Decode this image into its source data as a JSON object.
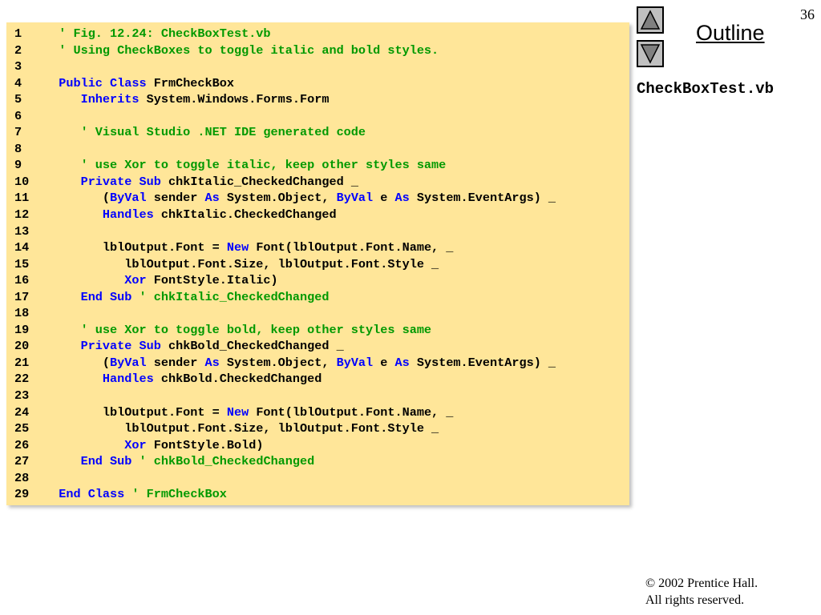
{
  "slide": {
    "page_number": "36",
    "outline_label": "Outline",
    "file_name": "CheckBoxTest.vb",
    "copyright_line1": "© 2002 Prentice Hall.",
    "copyright_line2": "All rights reserved."
  },
  "nav": {
    "prev_icon": "triangle-up-icon",
    "next_icon": "triangle-down-icon"
  },
  "colors": {
    "code_background": "#ffe699",
    "keyword": "#0000ff",
    "comment": "#009900",
    "text": "#000000"
  },
  "code": [
    {
      "n": "1",
      "segs": [
        {
          "t": "  ",
          "c": ""
        },
        {
          "t": "' Fig. 12.24: CheckBoxTest.vb",
          "c": "cm"
        }
      ]
    },
    {
      "n": "2",
      "segs": [
        {
          "t": "  ",
          "c": ""
        },
        {
          "t": "' Using CheckBoxes to toggle italic and bold styles.",
          "c": "cm"
        }
      ]
    },
    {
      "n": "3",
      "segs": []
    },
    {
      "n": "4",
      "segs": [
        {
          "t": "  ",
          "c": ""
        },
        {
          "t": "Public",
          "c": "kw"
        },
        {
          "t": " ",
          "c": ""
        },
        {
          "t": "Class",
          "c": "kw"
        },
        {
          "t": " FrmCheckBox",
          "c": ""
        }
      ]
    },
    {
      "n": "5",
      "segs": [
        {
          "t": "     ",
          "c": ""
        },
        {
          "t": "Inherits",
          "c": "kw"
        },
        {
          "t": " System.Windows.Forms.Form",
          "c": ""
        }
      ]
    },
    {
      "n": "6",
      "segs": []
    },
    {
      "n": "7",
      "segs": [
        {
          "t": "     ",
          "c": ""
        },
        {
          "t": "' Visual Studio .NET IDE generated code",
          "c": "cm"
        }
      ]
    },
    {
      "n": "8",
      "segs": []
    },
    {
      "n": "9",
      "segs": [
        {
          "t": "     ",
          "c": ""
        },
        {
          "t": "' use Xor to toggle italic, keep other styles same",
          "c": "cm"
        }
      ]
    },
    {
      "n": "10",
      "segs": [
        {
          "t": "     ",
          "c": ""
        },
        {
          "t": "Private",
          "c": "kw"
        },
        {
          "t": " ",
          "c": ""
        },
        {
          "t": "Sub",
          "c": "kw"
        },
        {
          "t": " chkItalic_CheckedChanged _",
          "c": ""
        }
      ]
    },
    {
      "n": "11",
      "segs": [
        {
          "t": "        (",
          "c": ""
        },
        {
          "t": "ByVal",
          "c": "kw"
        },
        {
          "t": " sender ",
          "c": ""
        },
        {
          "t": "As",
          "c": "kw"
        },
        {
          "t": " System.Object, ",
          "c": ""
        },
        {
          "t": "ByVal",
          "c": "kw"
        },
        {
          "t": " e ",
          "c": ""
        },
        {
          "t": "As",
          "c": "kw"
        },
        {
          "t": " System.EventArgs) _",
          "c": ""
        }
      ]
    },
    {
      "n": "12",
      "segs": [
        {
          "t": "        ",
          "c": ""
        },
        {
          "t": "Handles",
          "c": "kw"
        },
        {
          "t": " chkItalic.CheckedChanged",
          "c": ""
        }
      ]
    },
    {
      "n": "13",
      "segs": []
    },
    {
      "n": "14",
      "segs": [
        {
          "t": "        lblOutput.Font = ",
          "c": ""
        },
        {
          "t": "New",
          "c": "kw"
        },
        {
          "t": " Font(lblOutput.Font.Name, _",
          "c": ""
        }
      ]
    },
    {
      "n": "15",
      "segs": [
        {
          "t": "           lblOutput.Font.Size, lblOutput.Font.Style _",
          "c": ""
        }
      ]
    },
    {
      "n": "16",
      "segs": [
        {
          "t": "           ",
          "c": ""
        },
        {
          "t": "Xor",
          "c": "kw"
        },
        {
          "t": " FontStyle.Italic)",
          "c": ""
        }
      ]
    },
    {
      "n": "17",
      "segs": [
        {
          "t": "     ",
          "c": ""
        },
        {
          "t": "End",
          "c": "kw"
        },
        {
          "t": " ",
          "c": ""
        },
        {
          "t": "Sub",
          "c": "kw"
        },
        {
          "t": " ",
          "c": ""
        },
        {
          "t": "' chkItalic_CheckedChanged",
          "c": "cm"
        }
      ]
    },
    {
      "n": "18",
      "segs": []
    },
    {
      "n": "19",
      "segs": [
        {
          "t": "     ",
          "c": ""
        },
        {
          "t": "' use Xor to toggle bold, keep other styles same",
          "c": "cm"
        }
      ]
    },
    {
      "n": "20",
      "segs": [
        {
          "t": "     ",
          "c": ""
        },
        {
          "t": "Private",
          "c": "kw"
        },
        {
          "t": " ",
          "c": ""
        },
        {
          "t": "Sub",
          "c": "kw"
        },
        {
          "t": " chkBold_CheckedChanged _",
          "c": ""
        }
      ]
    },
    {
      "n": "21",
      "segs": [
        {
          "t": "        (",
          "c": ""
        },
        {
          "t": "ByVal",
          "c": "kw"
        },
        {
          "t": " sender ",
          "c": ""
        },
        {
          "t": "As",
          "c": "kw"
        },
        {
          "t": " System.Object, ",
          "c": ""
        },
        {
          "t": "ByVal",
          "c": "kw"
        },
        {
          "t": " e ",
          "c": ""
        },
        {
          "t": "As",
          "c": "kw"
        },
        {
          "t": " System.EventArgs) _",
          "c": ""
        }
      ]
    },
    {
      "n": "22",
      "segs": [
        {
          "t": "        ",
          "c": ""
        },
        {
          "t": "Handles",
          "c": "kw"
        },
        {
          "t": " chkBold.CheckedChanged",
          "c": ""
        }
      ]
    },
    {
      "n": "23",
      "segs": []
    },
    {
      "n": "24",
      "segs": [
        {
          "t": "        lblOutput.Font = ",
          "c": ""
        },
        {
          "t": "New",
          "c": "kw"
        },
        {
          "t": " Font(lblOutput.Font.Name, _",
          "c": ""
        }
      ]
    },
    {
      "n": "25",
      "segs": [
        {
          "t": "           lblOutput.Font.Size, lblOutput.Font.Style _",
          "c": ""
        }
      ]
    },
    {
      "n": "26",
      "segs": [
        {
          "t": "           ",
          "c": ""
        },
        {
          "t": "Xor",
          "c": "kw"
        },
        {
          "t": " FontStyle.Bold)",
          "c": ""
        }
      ]
    },
    {
      "n": "27",
      "segs": [
        {
          "t": "     ",
          "c": ""
        },
        {
          "t": "End",
          "c": "kw"
        },
        {
          "t": " ",
          "c": ""
        },
        {
          "t": "Sub",
          "c": "kw"
        },
        {
          "t": " ",
          "c": ""
        },
        {
          "t": "' chkBold_CheckedChanged",
          "c": "cm"
        }
      ]
    },
    {
      "n": "28",
      "segs": []
    },
    {
      "n": "29",
      "segs": [
        {
          "t": "  ",
          "c": ""
        },
        {
          "t": "End",
          "c": "kw"
        },
        {
          "t": " ",
          "c": ""
        },
        {
          "t": "Class",
          "c": "kw"
        },
        {
          "t": " ",
          "c": ""
        },
        {
          "t": "' FrmCheckBox",
          "c": "cm"
        }
      ]
    }
  ]
}
